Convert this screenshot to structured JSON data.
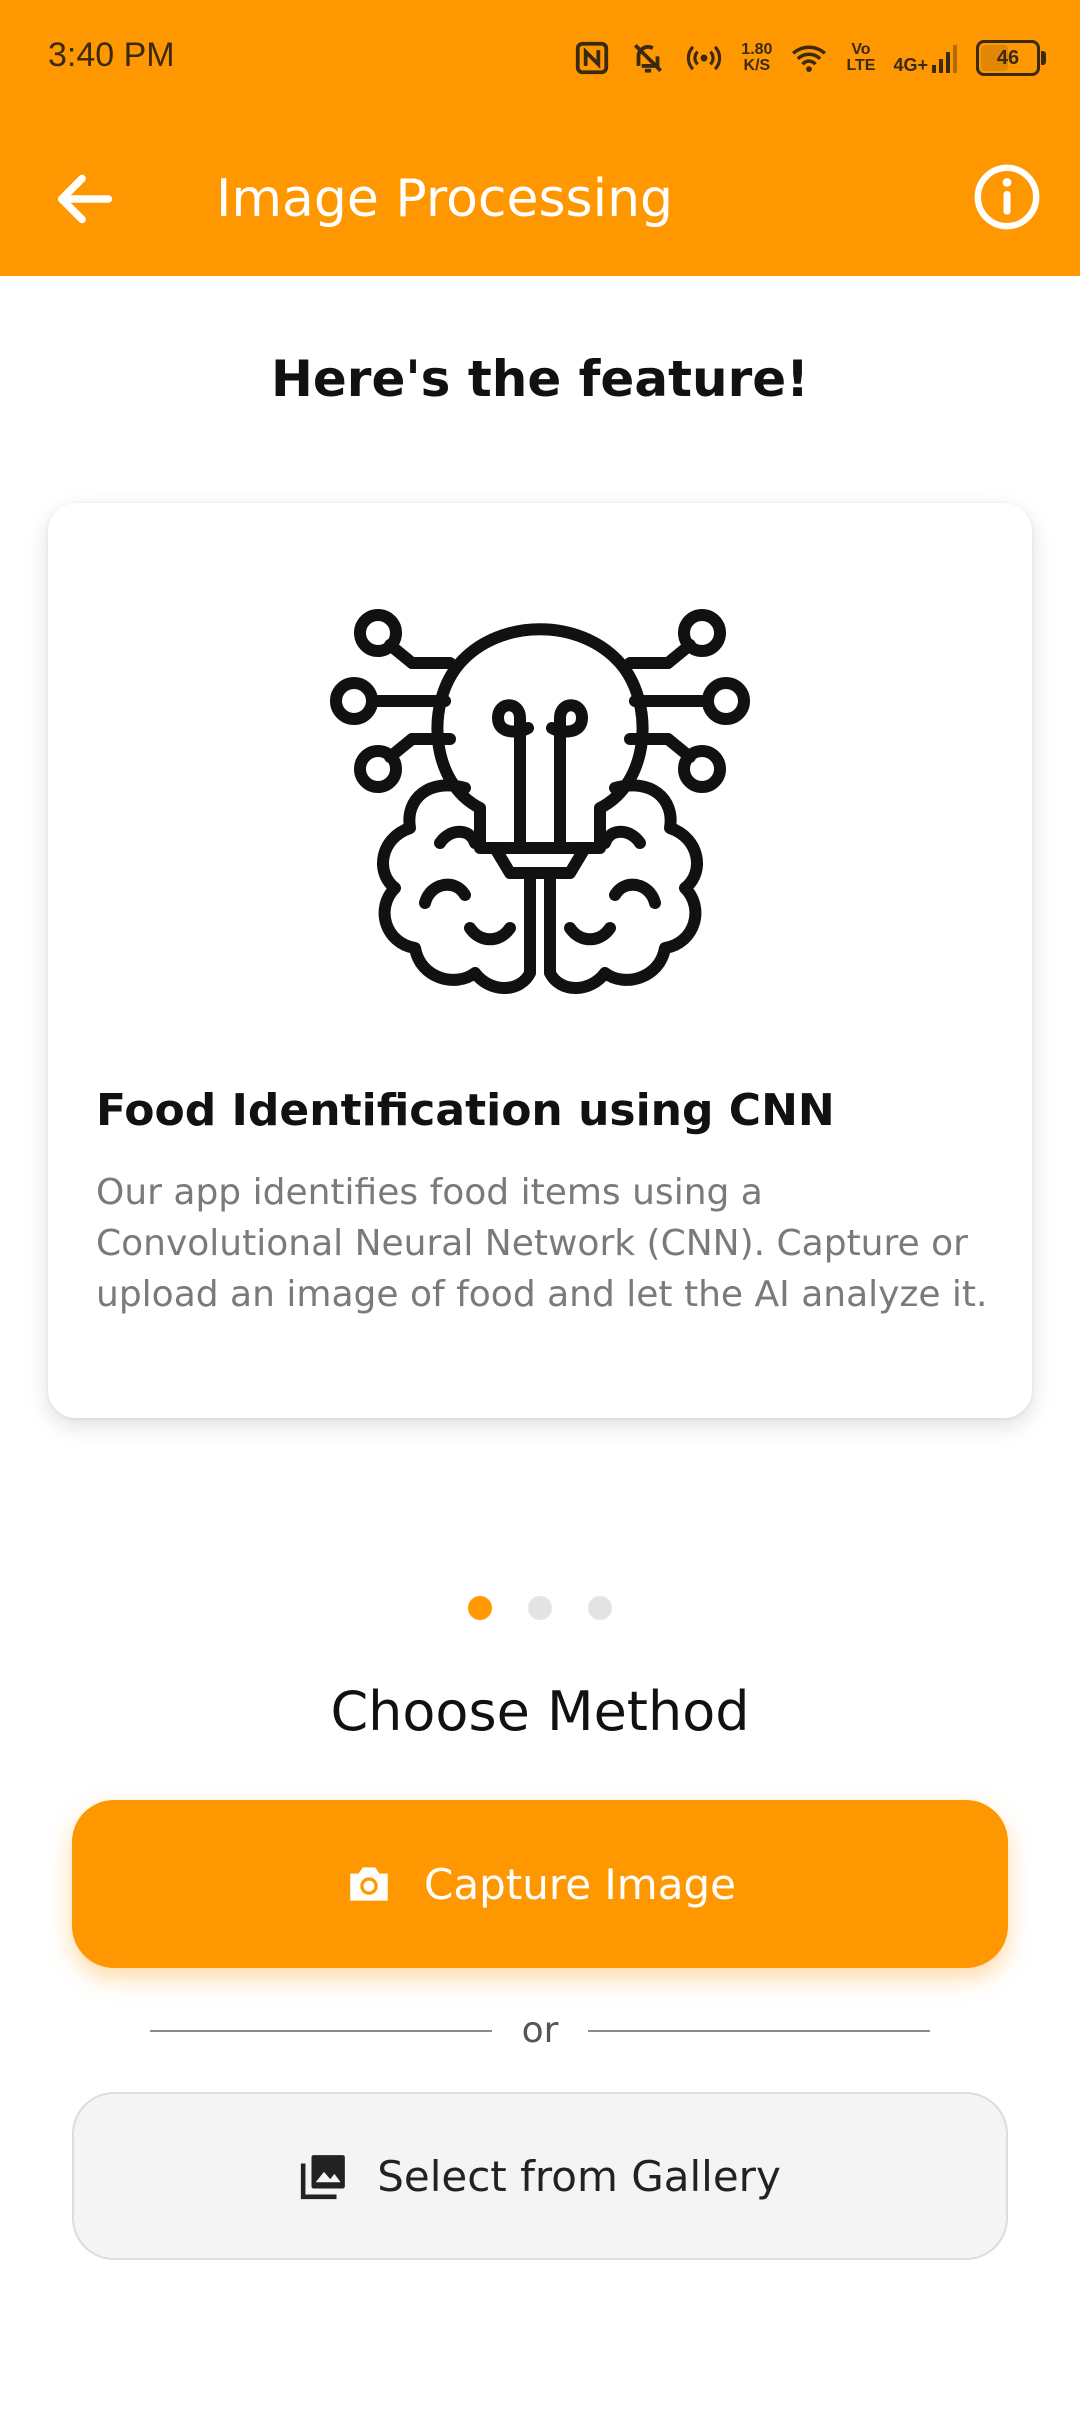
{
  "status_bar": {
    "time": "3:40 PM",
    "network_speed_value": "1.80",
    "network_speed_unit": "K/S",
    "volte_top": "Vo",
    "volte_bottom": "LTE",
    "cellular": "4G+",
    "battery": "46",
    "icons": [
      "nfc-icon",
      "bell-off-icon",
      "hotspot-icon",
      "wifi-icon",
      "signal-icon",
      "battery-icon"
    ]
  },
  "app_bar": {
    "title": "Image Processing",
    "back_icon": "arrow-back-icon",
    "info_icon": "info-icon"
  },
  "headline": "Here's the feature!",
  "carousel": {
    "card": {
      "illustration_icon": "brain-lightbulb-icon",
      "title": "Food Identification using CNN",
      "description": "Our app identifies food items using a Convolutional Neural Network (CNN). Capture or upload an image of food and let the AI analyze it."
    },
    "page_count": 3,
    "active_index": 0
  },
  "method": {
    "heading": "Choose Method",
    "capture_label": "Capture Image",
    "or_label": "or",
    "gallery_label": "Select from Gallery"
  },
  "colors": {
    "accent": "#FF9800",
    "dot_inactive": "#E3E3E3",
    "text_dark": "#111111",
    "text_muted": "#7A7A7A"
  }
}
